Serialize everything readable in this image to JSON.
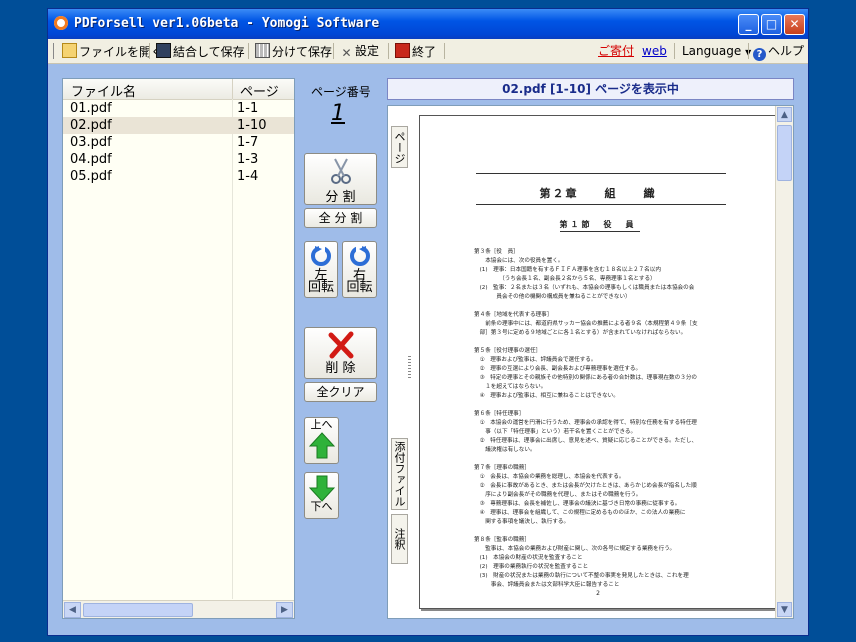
{
  "titlebar": {
    "title": "PDForsell ver1.06beta - Yomogi Software",
    "min": "_",
    "max": "□",
    "close": "✕"
  },
  "menubar": {
    "open": "ファイルを開く",
    "merge_save": "結合して保存",
    "split_save": "分けて保存",
    "settings": "設定",
    "exit": "終了",
    "donate": "ご寄付",
    "web": "web",
    "language": "Language",
    "help": "ヘルプ"
  },
  "filelist": {
    "headers": {
      "name": "ファイル名",
      "page": "ページ"
    },
    "rows": [
      {
        "name": "01.pdf",
        "page": "1-1"
      },
      {
        "name": "02.pdf",
        "page": "1-10"
      },
      {
        "name": "03.pdf",
        "page": "1-7"
      },
      {
        "name": "04.pdf",
        "page": "1-3"
      },
      {
        "name": "05.pdf",
        "page": "1-4"
      }
    ],
    "selected_index": 1
  },
  "controls": {
    "page_number_label": "ページ番号",
    "page_number": "1",
    "split": "分 割",
    "split_all": "全 分 割",
    "rotate_left_1": "左",
    "rotate_left_2": "回転",
    "rotate_right_1": "右",
    "rotate_right_2": "回転",
    "delete": "削 除",
    "clear_all": "全クリア",
    "move_up": "上へ",
    "move_down": "下へ"
  },
  "viewer": {
    "header": "02.pdf  [1-10] ページを表示中",
    "tabs": {
      "pages": "ページ",
      "attachments": "添付ファイル",
      "annotations": "注釈"
    }
  },
  "document": {
    "chapter": "第２章　　組　　織",
    "section": "第１節　役　員",
    "lines": [
      "第３条［役　員］",
      "　　本協会には、次の役員を置く。",
      "　(1)　理事：日本国籍を有するＦＩＦＡ理事を含む１８名以上２７名以内",
      "　　　　　（うち会長１名、副会長２名から５名、専務理事１名とする）",
      "　(2)　監事：２名または３名（いずれも、本協会の理事もしくは職員または本協会の会",
      "　　　　員会その他の機関の構成員を兼ねることができない）",
      "",
      "第４条［地域を代表する理事］",
      "　　前条の理事中には、都道府県サッカー協会の推薦による者９名（本規程第４９条［支",
      "　部］第３号に定める９地域ごとに各１名とする）が含まれていなければならない。",
      "",
      "第５条［役付理事の選任］",
      "　①　理事および監事は、評議員会で選任する。",
      "　②　理事の互選により会長、副会長および専務理事を選任する。",
      "　③　特定の理事とその親族その他特別の関係にある者の合計数は、理事現在数の３分の",
      "　　１を超えてはならない。",
      "　④　理事および監事は、相互に兼ねることはできない。",
      "",
      "第６条［特任理事］",
      "　①　本協会の運営を円滑に行うため、理事会の承認を得て、特別な任務を有する特任理",
      "　　事（以下「特任理事」という）若干名を置くことができる。",
      "　②　特任理事は、理事会に出席し、意見を述べ、質疑に応じることができる。ただし、",
      "　　議決権は有しない。",
      "",
      "第７条［理事の職務］",
      "　①　会長は、本協会の業務を総理し、本協会を代表する。",
      "　②　会長に事故があるとき、または会長が欠けたときは、あらかじめ会長が指名した順",
      "　　序により副会長がその職務を代理し、またはその職務を行う。",
      "　③　専務理事は、会長を補佐し、理事会の議決に基づき日常の事務に従事する。",
      "　④　理事は、理事会を組織して、この規程に定めるもののほか、この法人の業務に",
      "　　関する事項を議決し、執行する。",
      "",
      "第８条［監事の職務］",
      "　　監事は、本協会の業務および財産に関し、次の各号に規定する業務を行う。",
      "　(1)　本協会の財産の状況を監査すること",
      "　(2)　理事の業務執行の状況を監査すること",
      "　(3)　財産の状況または業務の執行について不整の事実を発見したときは、これを理",
      "　　　事会、評議員会または文部科学大臣に報告すること"
    ],
    "page_footer": "2"
  }
}
